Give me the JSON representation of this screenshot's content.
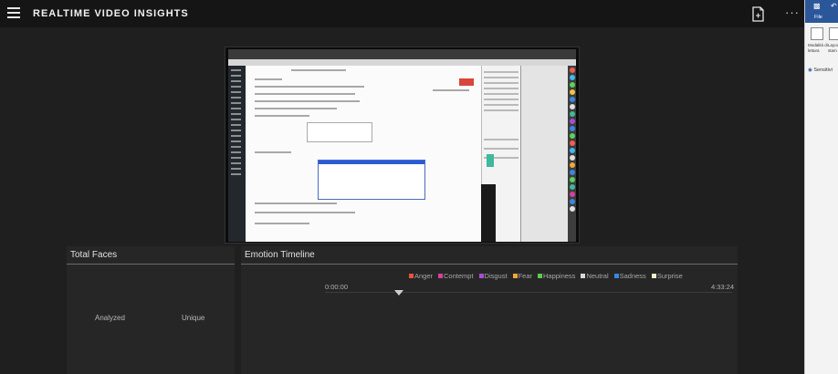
{
  "app": {
    "title": "REALTIME VIDEO INSIGHTS",
    "menu_icon": "hamburger-icon",
    "save_icon": "document-icon",
    "more_icon": "more-icon",
    "more_glyph": "···"
  },
  "total_faces": {
    "title": "Total Faces",
    "analyzed_label": "Analyzed",
    "unique_label": "Unique"
  },
  "emotion_timeline": {
    "title": "Emotion Timeline",
    "start_time": "0:00:00",
    "end_time": "4:33:24",
    "legend": [
      {
        "label": "Anger",
        "color": "#e8543a"
      },
      {
        "label": "Contempt",
        "color": "#d6409f"
      },
      {
        "label": "Disgust",
        "color": "#a64fd1"
      },
      {
        "label": "Fear",
        "color": "#f0a93b"
      },
      {
        "label": "Happiness",
        "color": "#5ec94e"
      },
      {
        "label": "Neutral",
        "color": "#d8d8d8"
      },
      {
        "label": "Sadness",
        "color": "#3d86e0"
      },
      {
        "label": "Surprise",
        "color": "#f2eec8"
      }
    ]
  },
  "office": {
    "file_label": "File",
    "item1": "Modalità di lettura",
    "item2": "Layout stam",
    "sensitivity": "Sensitivi"
  },
  "colors": {
    "background": "#1f1f1f",
    "panel": "#262626",
    "ribbon": "#2b579a"
  }
}
